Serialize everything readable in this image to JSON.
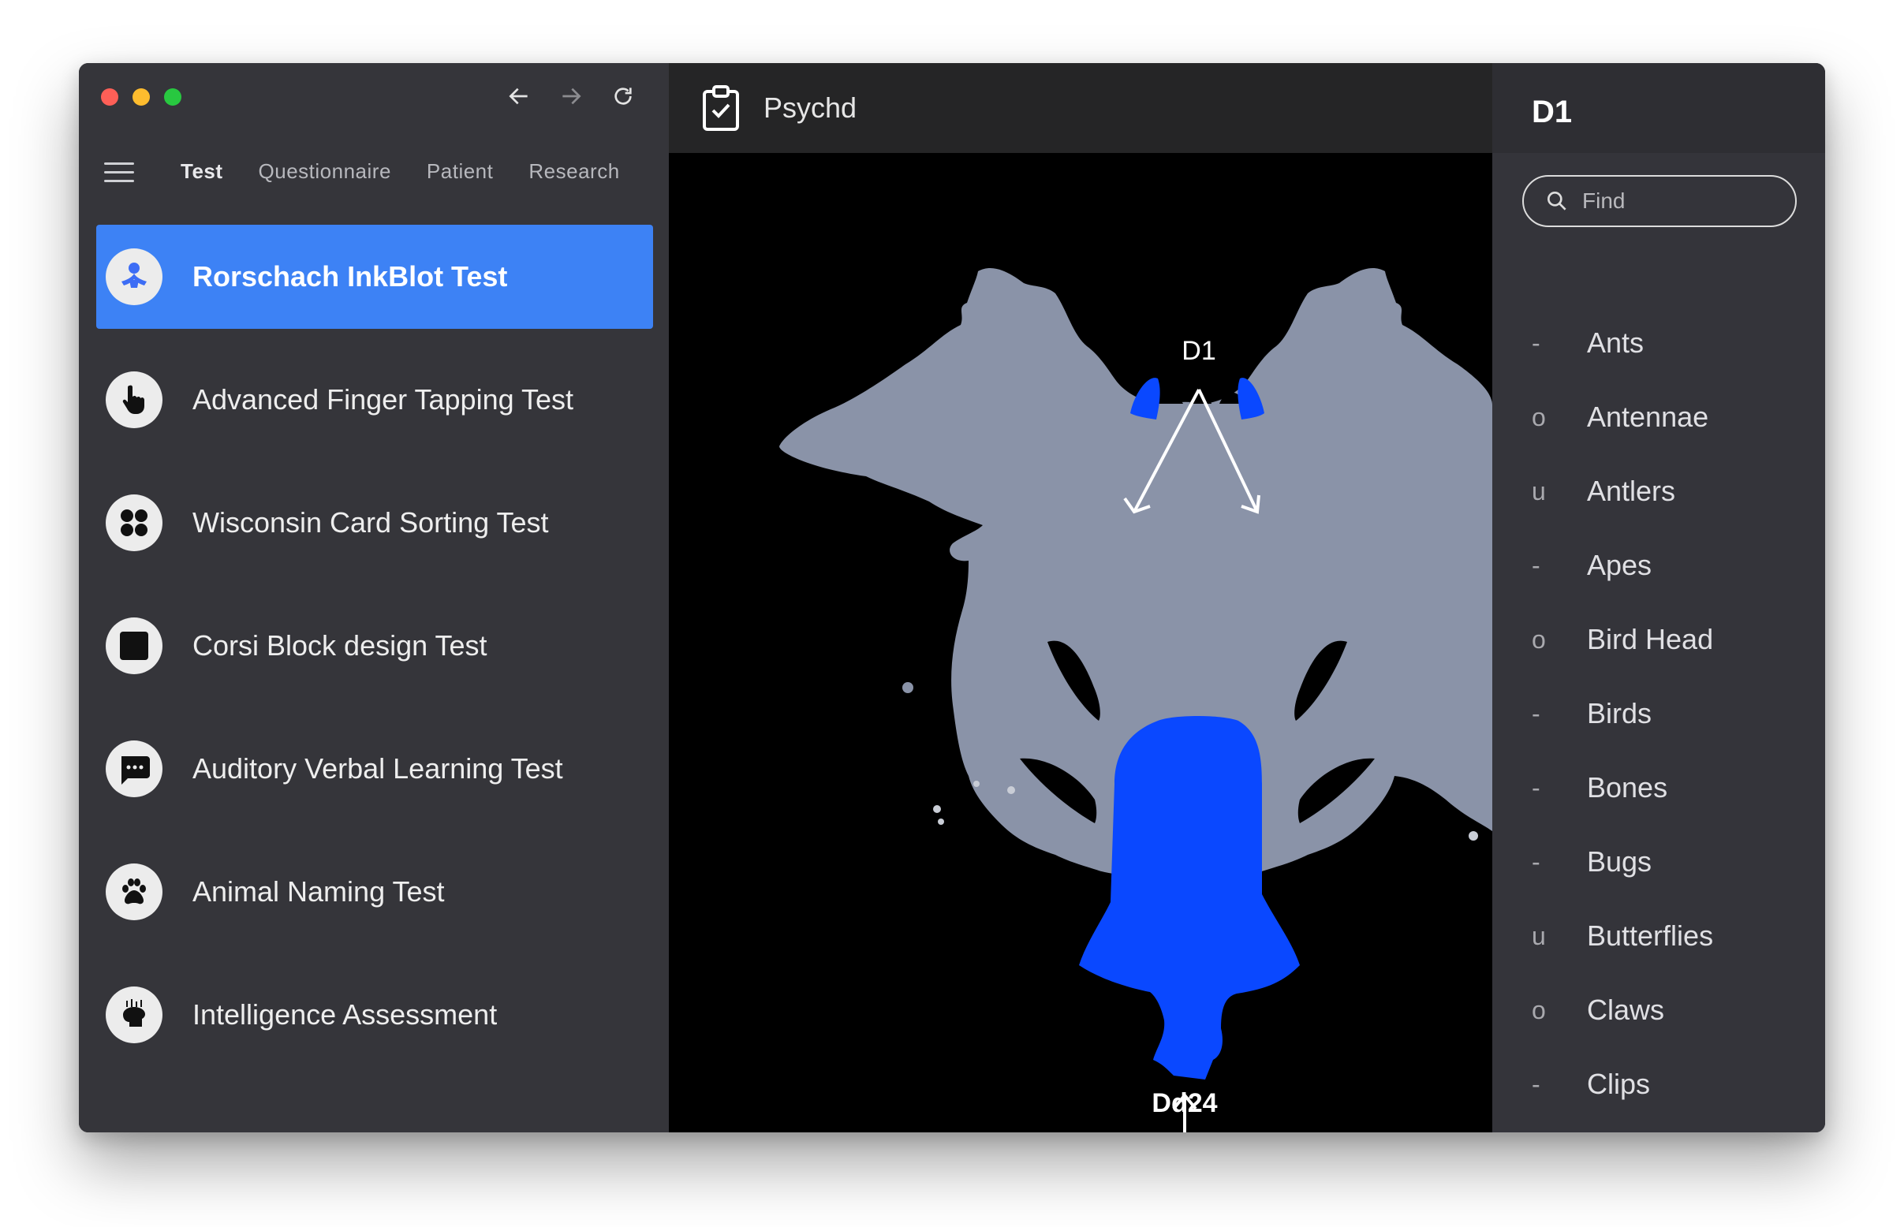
{
  "app": {
    "title": "Psychd"
  },
  "window_controls": {
    "close_color": "#fe5f57",
    "minimize_color": "#febc2e",
    "maximize_color": "#28c840"
  },
  "nav": {
    "tabs": [
      "Test",
      "Questionnaire",
      "Patient",
      "Research"
    ],
    "active_tab": "Test"
  },
  "accent_color": "#3d82f5",
  "tests": [
    {
      "label": "Rorschach InkBlot Test",
      "icon": "inkblot-person-icon",
      "active": true
    },
    {
      "label": "Advanced Finger Tapping Test",
      "icon": "pointing-hand-icon",
      "active": false
    },
    {
      "label": "Wisconsin Card Sorting Test",
      "icon": "four-dots-icon",
      "active": false
    },
    {
      "label": "Corsi Block design Test",
      "icon": "square-block-icon",
      "active": false
    },
    {
      "label": "Auditory Verbal Learning Test",
      "icon": "chat-bubble-icon",
      "active": false
    },
    {
      "label": "Animal Naming Test",
      "icon": "paw-icon",
      "active": false
    },
    {
      "label": "Intelligence Assessment",
      "icon": "brain-head-icon",
      "active": false
    }
  ],
  "inkblot": {
    "annotations": {
      "top_label": "D1",
      "bottom_label": "Dd24"
    },
    "highlight_color": "#0a48ff",
    "blot_color": "#8a93a8"
  },
  "panel": {
    "title": "D1",
    "search_placeholder": "Find",
    "responses": [
      {
        "code": "-",
        "label": "Ants"
      },
      {
        "code": "o",
        "label": "Antennae"
      },
      {
        "code": "u",
        "label": "Antlers"
      },
      {
        "code": "-",
        "label": "Apes"
      },
      {
        "code": "o",
        "label": "Bird Head"
      },
      {
        "code": "-",
        "label": "Birds"
      },
      {
        "code": "-",
        "label": "Bones"
      },
      {
        "code": "-",
        "label": "Bugs"
      },
      {
        "code": "u",
        "label": "Butterflies"
      },
      {
        "code": "o",
        "label": "Claws"
      },
      {
        "code": "-",
        "label": "Clips"
      }
    ]
  }
}
